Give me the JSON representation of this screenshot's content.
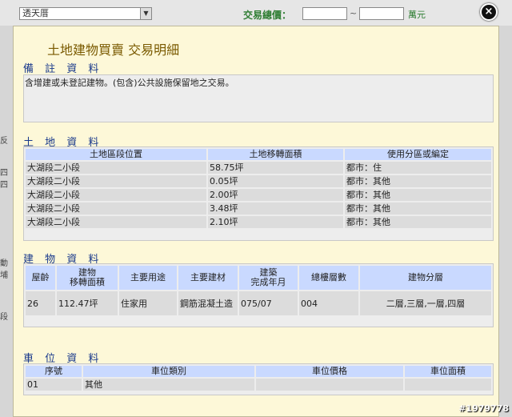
{
  "background": {
    "select_value": "透天厝",
    "total_price_label": "交易總價：",
    "range_sep": "~",
    "unit": "萬元",
    "side_texts": [
      "反",
      "四四",
      "動埔",
      "段"
    ],
    "watermark": "#1979778"
  },
  "modal": {
    "title": "土地建物買賣 交易明細",
    "close_label": "×",
    "remarks": {
      "heading": "備 註 資 料",
      "text": "含增建或未登記建物。(包含)公共設施保留地之交易。"
    },
    "land": {
      "heading": "土 地 資 料",
      "columns": [
        "土地區段位置",
        "土地移轉面積",
        "使用分區或編定"
      ],
      "rows": [
        [
          "大湖段二小段",
          "58.75坪",
          "都市：住"
        ],
        [
          "大湖段二小段",
          "0.05坪",
          "都市：其他"
        ],
        [
          "大湖段二小段",
          "2.00坪",
          "都市：其他"
        ],
        [
          "大湖段二小段",
          "3.48坪",
          "都市：其他"
        ],
        [
          "大湖段二小段",
          "2.10坪",
          "都市：其他"
        ]
      ]
    },
    "building": {
      "heading": "建 物 資 料",
      "columns": [
        "屋齡",
        "建物\n移轉面積",
        "主要用途",
        "主要建材",
        "建築\n完成年月",
        "總樓層數",
        "建物分層"
      ],
      "rows": [
        [
          "26",
          "112.47坪",
          "住家用",
          "鋼筋混凝土造",
          "075/07",
          "004",
          "二層,三層,一層,四層"
        ]
      ]
    },
    "parking": {
      "heading": "車 位 資 料",
      "columns": [
        "序號",
        "車位類別",
        "車位價格",
        "車位面積"
      ],
      "rows": [
        [
          "01",
          "其他",
          "",
          ""
        ]
      ]
    }
  }
}
